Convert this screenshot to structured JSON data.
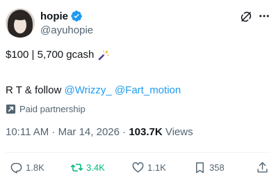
{
  "author": {
    "display_name": "hopie",
    "handle": "@ayuhopie",
    "verified": true
  },
  "tweet": {
    "line1": "$100 | 5,700 gcash",
    "line1_emoji": "magic-wand-emoji",
    "line2_prefix": "R T & follow ",
    "mentions": [
      "@Wrizzy_",
      "@Fart_motion"
    ],
    "paid_label": "Paid partnership",
    "timestamp": "10:11 AM · Mar 14, 2026 · ",
    "views_count": "103.7K",
    "views_label": " Views"
  },
  "actions": {
    "replies": "1.8K",
    "reposts": "3.4K",
    "likes": "1.1K",
    "bookmarks": "358"
  },
  "colors": {
    "accent": "#1d9bf0",
    "repost_active": "#00ba7c",
    "secondary_text": "#536471",
    "primary_text": "#0f1419"
  },
  "icons": [
    "verified-badge-icon",
    "grok-icon",
    "more-icon",
    "paid-partnership-icon",
    "reply-icon",
    "repost-icon",
    "like-icon",
    "bookmark-icon",
    "share-icon"
  ]
}
